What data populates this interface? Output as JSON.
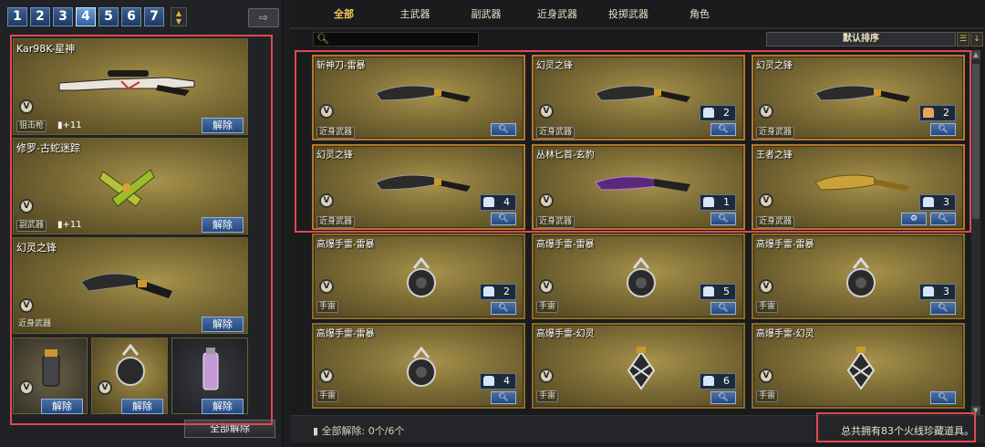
{
  "left_panel": {
    "pages": [
      "1",
      "2",
      "3",
      "4",
      "5",
      "6",
      "7"
    ],
    "active_page": "4",
    "share_icon": "share-arrow-icon",
    "unequip_label": "解除",
    "all_unequip_label": "全部解除",
    "equipped": [
      {
        "name": "Kar98K-星神",
        "category": "狙击枪",
        "level": "+11",
        "weapon_icon": "sniper-rifle-icon"
      },
      {
        "name": "修罗-古蛇迷踪",
        "category": "副武器",
        "level": "+11",
        "weapon_icon": "dual-pistols-icon"
      },
      {
        "name": "幻灵之锋",
        "category": "近身武器",
        "level": "",
        "weapon_icon": "knife-icon"
      }
    ],
    "small_slots": [
      {
        "weapon_icon": "grenade-icon"
      },
      {
        "weapon_icon": "grenade-icon"
      },
      {
        "weapon_icon": "spray-can-icon"
      }
    ]
  },
  "right_panel": {
    "tabs": [
      "全部",
      "主武器",
      "副武器",
      "近身武器",
      "投掷武器",
      "角色"
    ],
    "active_tab": "全部",
    "search_placeholder": "",
    "sort_label": "默认排序",
    "items": [
      {
        "name": "斩神刀-雷暴",
        "category": "近身武器",
        "count": "",
        "crate": "",
        "gear": false
      },
      {
        "name": "幻灵之锋",
        "category": "近身武器",
        "count": "2",
        "crate": "blue",
        "gear": false
      },
      {
        "name": "幻灵之锋",
        "category": "近身武器",
        "count": "2",
        "crate": "gold",
        "gear": false
      },
      {
        "name": "幻灵之锋",
        "category": "近身武器",
        "count": "4",
        "crate": "blue",
        "gear": false
      },
      {
        "name": "丛林匕首-玄豹",
        "category": "近身武器",
        "count": "1",
        "crate": "blue",
        "gear": false
      },
      {
        "name": "王者之锋",
        "category": "近身武器",
        "count": "3",
        "crate": "blue",
        "gear": true
      },
      {
        "name": "高爆手雷-雷暴",
        "category": "手雷",
        "count": "2",
        "crate": "blue",
        "gear": false
      },
      {
        "name": "高爆手雷-雷暴",
        "category": "手雷",
        "count": "5",
        "crate": "blue",
        "gear": false
      },
      {
        "name": "高爆手雷-雷暴",
        "category": "手雷",
        "count": "3",
        "crate": "blue",
        "gear": false
      },
      {
        "name": "高爆手雷-雷暴",
        "category": "手雷",
        "count": "4",
        "crate": "blue",
        "gear": false
      },
      {
        "name": "高爆手雷-幻灵",
        "category": "手雷",
        "count": "6",
        "crate": "blue",
        "gear": false
      },
      {
        "name": "高爆手雷-幻灵",
        "category": "手雷",
        "count": "",
        "crate": "",
        "gear": false
      }
    ],
    "unequip_status": "全部解除: 0个/6个",
    "total_text": "总共拥有83个火线珍藏道具。"
  },
  "colors": {
    "highlight_box": "#e04950",
    "active_tab": "#f3c85a",
    "card_gold": "#a7934c",
    "button_blue": "#2e5f9e"
  }
}
